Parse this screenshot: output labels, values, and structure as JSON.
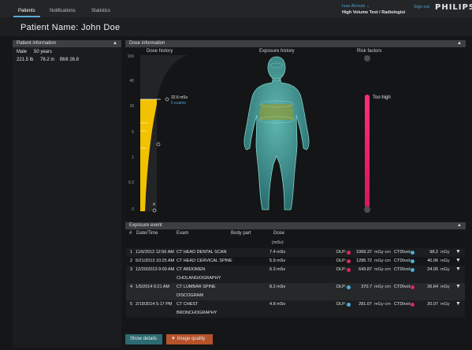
{
  "nav": {
    "tabs": [
      {
        "label": "Patients"
      },
      {
        "label": "Notifications"
      },
      {
        "label": "Statistics"
      }
    ],
    "user_name": "Ivan Atroum",
    "user_role": "High Volume Test / Radiologist",
    "signout": "Sign out",
    "brand": "PHILIPS"
  },
  "page_title": "Patient Name: John Doe",
  "patient_info": {
    "header": "Patient information",
    "sex": "Male",
    "age": "50 years",
    "weight": "221.5 lb",
    "height": "76.2 in",
    "bmi": "BMI 26.8"
  },
  "dose_info": {
    "header": "Dose information",
    "dose_history_title": "Dose history",
    "exposure_history_title": "Exposure history",
    "risk_factors_title": "Risk factors",
    "annotation_value": "32.6 mSv",
    "annotation_sub": "5 exams",
    "risk_label": "Too high",
    "y_ticks": [
      "100",
      "40",
      "16",
      "5",
      "1",
      "0.2",
      "0"
    ]
  },
  "exposure_event": {
    "header": "Exposure event",
    "columns": {
      "num": "#",
      "date": "Date/Time",
      "exam": "Exam",
      "body": "Body part",
      "dose": "Dose",
      "dose_unit": "(mSv)"
    },
    "rows": [
      {
        "num": "1",
        "date": "11/6/2012 12:56 AM",
        "exam": "CT HEAD DENTAL SCAN",
        "exam2": "",
        "dose": "7.4 mSv",
        "dlp_label": "DLP:",
        "dlp_color": "#e0245e",
        "dlp_value": "1069.37",
        "dlp_unit": "mGy·cm",
        "ctdi_label": "CTDIvol:",
        "ctdi_color": "#4ab0d0",
        "ctdi_value": "98.2",
        "ctdi_unit": "mGy"
      },
      {
        "num": "2",
        "date": "5/21/2013 10:25 AM",
        "exam": "CT HEAD CERVICAL SPINE",
        "exam2": "",
        "dose": "5.9 mSv",
        "dlp_label": "DLP:",
        "dlp_color": "#e0245e",
        "dlp_value": "1286.72",
        "dlp_unit": "mGy·cm",
        "ctdi_label": "CTDIvol:",
        "ctdi_color": "#4ab0d0",
        "ctdi_value": "40.06",
        "ctdi_unit": "mGy"
      },
      {
        "num": "3",
        "date": "12/20/2013 9:09 AM",
        "exam": "CT ABDOMEN",
        "exam2": "CHOLANGIOGRAPHY",
        "dose": "6.3 mSv",
        "dlp_label": "DLP:",
        "dlp_color": "#e0245e",
        "dlp_value": "643.87",
        "dlp_unit": "mGy·cm",
        "ctdi_label": "CTDIvol:",
        "ctdi_color": "#4ab0d0",
        "ctdi_value": "24.05",
        "ctdi_unit": "mGy"
      },
      {
        "num": "4",
        "date": "1/5/2014 9:21 AM",
        "exam": "CT LUMBAR SPINE",
        "exam2": "DISCOGRAM",
        "dose": "8.2 mSv",
        "dlp_label": "DLP:",
        "dlp_color": "#4ab0d0",
        "dlp_value": "370.7",
        "dlp_unit": "mGy·cm",
        "ctdi_label": "CTDIvol:",
        "ctdi_color": "#e0245e",
        "ctdi_value": "26.64",
        "ctdi_unit": "mGy"
      },
      {
        "num": "5",
        "date": "2/19/2014 5:17 PM",
        "exam": "CT CHEST",
        "exam2": "BRONCHOGRAPHY",
        "dose": "4.8 mSv",
        "dlp_label": "DLP:",
        "dlp_color": "#4ab0d0",
        "dlp_value": "281.07",
        "dlp_unit": "mGy·cm",
        "ctdi_label": "CTDIvol:",
        "ctdi_color": "#e0245e",
        "ctdi_value": "20.07",
        "ctdi_unit": "mGy"
      }
    ]
  },
  "buttons": {
    "show_details": "Show details",
    "image_quality": "Image quality"
  },
  "colors": {
    "accent": "#5aa9d6",
    "risk": "#e0245e",
    "dose_bar": "#f2c200",
    "button_teal": "#2d6b72",
    "button_orange": "#b5532a"
  }
}
